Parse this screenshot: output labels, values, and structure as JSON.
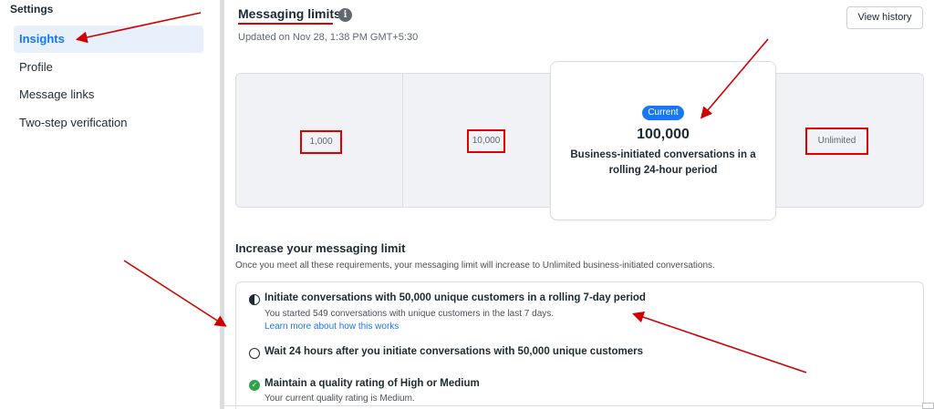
{
  "sidebar": {
    "title": "Settings",
    "items": [
      {
        "label": "Insights",
        "active": true
      },
      {
        "label": "Profile",
        "active": false
      },
      {
        "label": "Message links",
        "active": false
      },
      {
        "label": "Two-step verification",
        "active": false
      }
    ]
  },
  "header": {
    "title": "Messaging limits",
    "info_icon": "info-icon",
    "updated": "Updated on Nov 28, 1:38 PM GMT+5:30",
    "view_history": "View history"
  },
  "tiers": {
    "levels": [
      "1,000",
      "10,000",
      "100,000",
      "Unlimited"
    ],
    "current": {
      "badge": "Current",
      "value": "100,000",
      "description": "Business-initiated conversations in a rolling 24-hour period"
    }
  },
  "increase": {
    "heading": "Increase your messaging limit",
    "description": "Once you meet all these requirements, your messaging limit will increase to Unlimited business-initiated conversations.",
    "requirements": [
      {
        "status": "in-progress",
        "icon": "half-circle-icon",
        "title": "Initiate conversations with 50,000 unique customers in a rolling 7-day period",
        "detail": "You started 549 conversations with unique customers in the last 7 days.",
        "link": "Learn more about how this works"
      },
      {
        "status": "not-started",
        "icon": "empty-circle-icon",
        "title": "Wait 24 hours after you initiate conversations with 50,000 unique customers"
      },
      {
        "status": "complete",
        "icon": "check-circle-icon",
        "title": "Maintain a quality rating of High or Medium",
        "detail": "Your current quality rating is Medium."
      }
    ]
  },
  "colors": {
    "accent": "#1877f2",
    "annotation_red": "#e00000",
    "success": "#31a24c"
  }
}
